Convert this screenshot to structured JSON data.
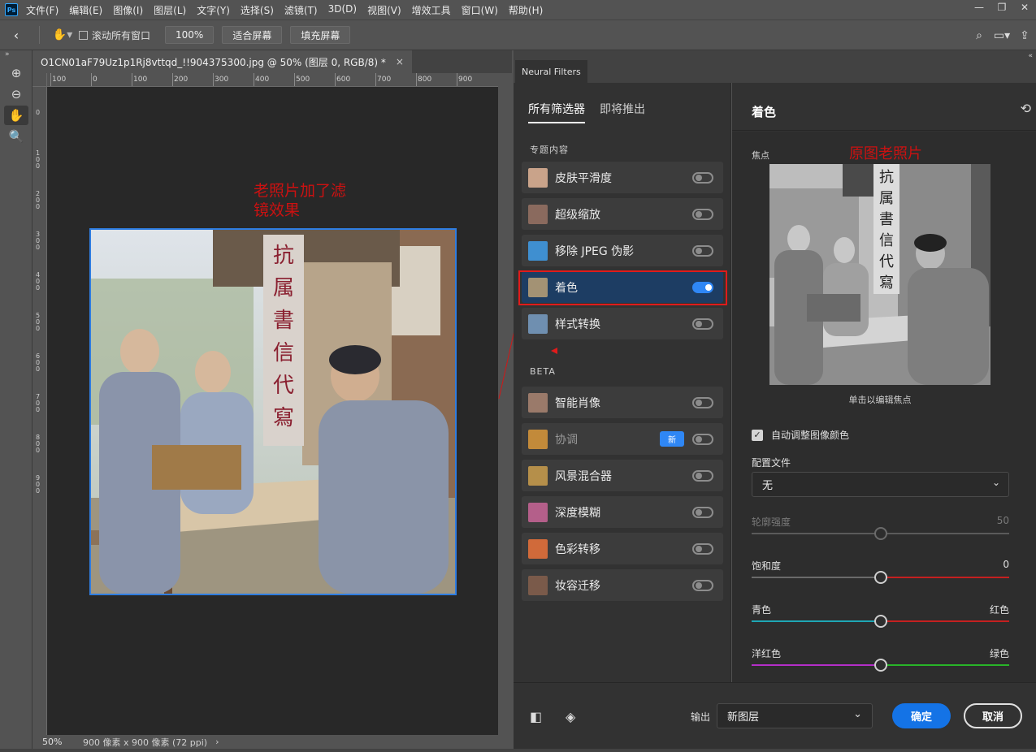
{
  "app": {
    "logo": "Ps"
  },
  "menu": [
    "文件(F)",
    "编辑(E)",
    "图像(I)",
    "图层(L)",
    "文字(Y)",
    "选择(S)",
    "滤镜(T)",
    "3D(D)",
    "视图(V)",
    "增效工具",
    "窗口(W)",
    "帮助(H)"
  ],
  "window_controls": {
    "minimize": "—",
    "restore": "❐",
    "close": "✕"
  },
  "options": {
    "scroll_all_label": "滚动所有窗口",
    "zoom_value": "100%",
    "fit_screen": "适合屏幕",
    "fill_screen": "填充屏幕"
  },
  "tools": [
    {
      "name": "zoom-in-icon",
      "glyph": "⊕"
    },
    {
      "name": "zoom-out-icon",
      "glyph": "⊖"
    },
    {
      "name": "hand-tool-icon",
      "glyph": "✋"
    },
    {
      "name": "magnifier-icon",
      "glyph": "🔍"
    }
  ],
  "document": {
    "tab_title": "O1CN01aF79Uz1p1Rj8vttqd_!!904375300.jpg @ 50% (图层 0, RGB/8) *",
    "close": "×",
    "annotation": "老照片加了滤镜效果"
  },
  "ruler": {
    "h_labels": [
      "100",
      "0",
      "100",
      "200",
      "300",
      "400",
      "500",
      "600",
      "700",
      "800",
      "900"
    ],
    "v_labels": [
      "0",
      "100",
      "200",
      "300",
      "400",
      "500",
      "600",
      "700",
      "800",
      "900"
    ]
  },
  "status": {
    "zoom": "50%",
    "info": "900 像素 x 900 像素 (72 ppi)",
    "more": "›"
  },
  "neural_filters": {
    "panel_tab": "Neural Filters",
    "tab_all": "所有筛选器",
    "tab_coming": "即将推出",
    "section_featured": "专题内容",
    "section_beta": "BETA",
    "featured": [
      {
        "label": "皮肤平滑度",
        "on": false,
        "thumb": "#c9a38a"
      },
      {
        "label": "超级缩放",
        "on": false,
        "thumb": "#8a6a5e"
      },
      {
        "label": "移除 JPEG 伪影",
        "on": false,
        "thumb": "#3f8fd0"
      },
      {
        "label": "着色",
        "on": true,
        "thumb": "#a39274"
      },
      {
        "label": "样式转换",
        "on": false,
        "thumb": "#6f8fb0"
      }
    ],
    "beta": [
      {
        "label": "智能肖像",
        "on": false,
        "thumb": "#9a7a6a"
      },
      {
        "label": "协调",
        "on": false,
        "thumb": "#c28a3a",
        "badge": "新",
        "dim": true
      },
      {
        "label": "风景混合器",
        "on": false,
        "thumb": "#b58f4a"
      },
      {
        "label": "深度模糊",
        "on": false,
        "thumb": "#b45f8a"
      },
      {
        "label": "色彩转移",
        "on": false,
        "thumb": "#d06a3a"
      },
      {
        "label": "妆容迁移",
        "on": false,
        "thumb": "#7a5a4a"
      }
    ],
    "detail": {
      "title": "着色",
      "focus_label": "焦点",
      "orig_annotation": "原图老照片",
      "focus_hint": "单击以编辑焦点",
      "auto_color_label": "自动调整图像颜色",
      "auto_color_checked": true,
      "profile_label": "配置文件",
      "profile_value": "无",
      "sliders": [
        {
          "label": "轮廓强度",
          "right": "50",
          "value": 50,
          "dim": true,
          "left_color": "#5a5a5a",
          "right_color": "#5a5a5a"
        },
        {
          "label": "饱和度",
          "right": "0",
          "value": 50,
          "dim": false,
          "left_color": "#6a6a6a",
          "right_color": "#c42020"
        },
        {
          "label": "青色",
          "right": "红色",
          "value": 50,
          "dim": false,
          "left_color": "#1ea6b4",
          "right_color": "#c42020"
        },
        {
          "label": "洋红色",
          "right": "绿色",
          "value": 50,
          "dim": false,
          "left_color": "#b42ec8",
          "right_color": "#28b428"
        }
      ]
    },
    "output_label": "输出",
    "output_value": "新图层",
    "ok": "确定",
    "cancel": "取消"
  }
}
